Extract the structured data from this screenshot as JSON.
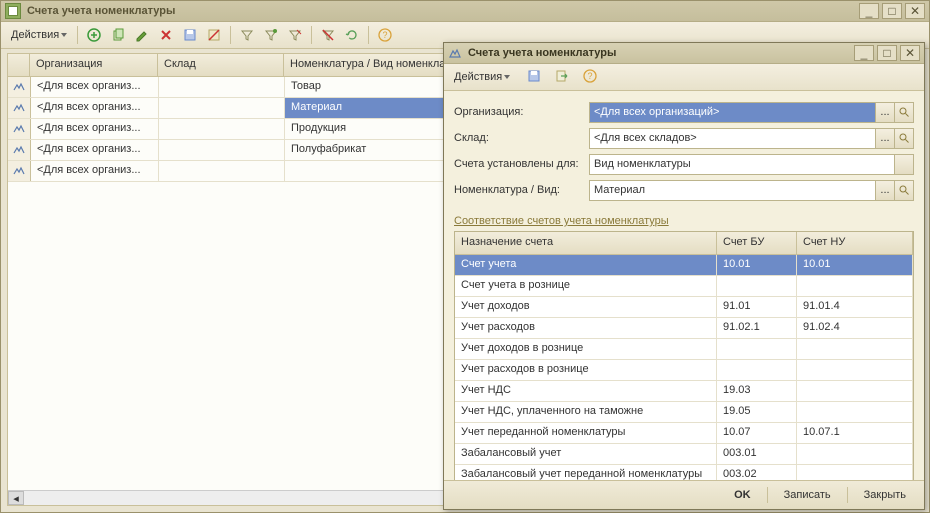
{
  "main_window": {
    "title": "Счета учета номенклатуры",
    "actions_label": "Действия",
    "grid": {
      "columns": {
        "org": "Организация",
        "sklad": "Склад",
        "nom": "Номенклатура / Вид номенклатуры"
      },
      "rows": [
        {
          "org": "<Для всех организ...",
          "sklad": "",
          "nom": "Товар"
        },
        {
          "org": "<Для всех организ...",
          "sklad": "",
          "nom": "Материал",
          "selected": true
        },
        {
          "org": "<Для всех организ...",
          "sklad": "",
          "nom": "Продукция"
        },
        {
          "org": "<Для всех организ...",
          "sklad": "",
          "nom": "Полуфабрикат"
        },
        {
          "org": "<Для всех организ...",
          "sklad": "",
          "nom": ""
        }
      ]
    }
  },
  "dialog": {
    "title": "Счета учета номенклатуры",
    "actions_label": "Действия",
    "form": {
      "org_label": "Организация:",
      "org_value": "<Для всех организаций>",
      "sklad_label": "Склад:",
      "sklad_value": "<Для всех складов>",
      "set_for_label": "Счета установлены для:",
      "set_for_value": "Вид номенклатуры",
      "nom_label": "Номенклатура / Вид:",
      "nom_value": "Материал"
    },
    "section_title": "Соответствие счетов учета номенклатуры",
    "table": {
      "columns": {
        "name": "Назначение счета",
        "bu": "Счет БУ",
        "nu": "Счет НУ"
      },
      "rows": [
        {
          "name": "Счет учета",
          "bu": "10.01",
          "nu": "10.01",
          "selected": true
        },
        {
          "name": "Счет учета в рознице",
          "bu": "",
          "nu": ""
        },
        {
          "name": "Учет доходов",
          "bu": "91.01",
          "nu": "91.01.4"
        },
        {
          "name": "Учет расходов",
          "bu": "91.02.1",
          "nu": "91.02.4"
        },
        {
          "name": "Учет доходов в рознице",
          "bu": "",
          "nu": ""
        },
        {
          "name": "Учет расходов в рознице",
          "bu": "",
          "nu": ""
        },
        {
          "name": "Учет НДС",
          "bu": "19.03",
          "nu": ""
        },
        {
          "name": "Учет НДС, уплаченного на таможне",
          "bu": "19.05",
          "nu": ""
        },
        {
          "name": "Учет переданной номенклатуры",
          "bu": "10.07",
          "nu": "10.07.1"
        },
        {
          "name": "Забалансовый учет",
          "bu": "003.01",
          "nu": ""
        },
        {
          "name": "Забалансовый учет переданной номенклатуры",
          "bu": "003.02",
          "nu": ""
        }
      ]
    },
    "footer": {
      "ok": "OK",
      "write": "Записать",
      "close": "Закрыть"
    }
  }
}
